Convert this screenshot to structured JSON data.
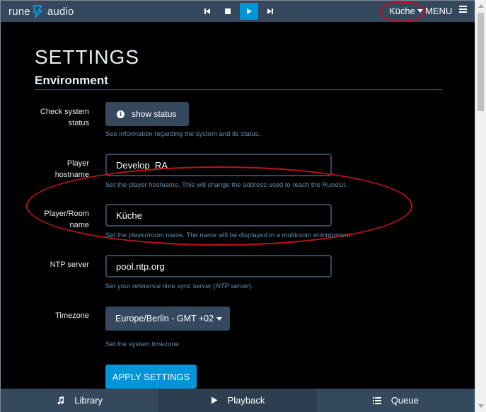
{
  "topbar": {
    "logo_left": "rune",
    "logo_right": "audio",
    "controls": [
      "previous-icon",
      "stop-icon",
      "play-icon",
      "next-icon"
    ],
    "room_selector": "Küche",
    "menu_label": "MENU"
  },
  "page": {
    "title": "SETTINGS",
    "section": "Environment"
  },
  "fields": {
    "status": {
      "label": "Check system status",
      "button": "show status",
      "help": "See information regarding the system and its status."
    },
    "hostname": {
      "label": "Player hostname",
      "value": "Develop_RA",
      "help": "Set the player hostname. This will change the address used to reach the RuneUI."
    },
    "room": {
      "label": "Player/Room name",
      "value": "Küche",
      "help": "Set the player/room name. The name will be displayed in a multiroom environment."
    },
    "ntp": {
      "label": "NTP server",
      "value": "pool.ntp.org",
      "help_prefix": "Set your reference time sync server (",
      "help_em": "NTP server",
      "help_suffix": ")."
    },
    "timezone": {
      "label": "Timezone",
      "value": "Europe/Berlin - GMT +02",
      "help": "Set the system timezone."
    }
  },
  "apply_button": "APPLY SETTINGS",
  "bottom_tabs": [
    {
      "label": "Library",
      "icon": "music-note-icon"
    },
    {
      "label": "Playback",
      "icon": "play-icon",
      "active": true
    },
    {
      "label": "Queue",
      "icon": "list-icon"
    }
  ],
  "colors": {
    "accent": "#0095d8",
    "bar": "#34495e",
    "help_text": "#5f8fb1",
    "annotation": "#c0121b"
  }
}
